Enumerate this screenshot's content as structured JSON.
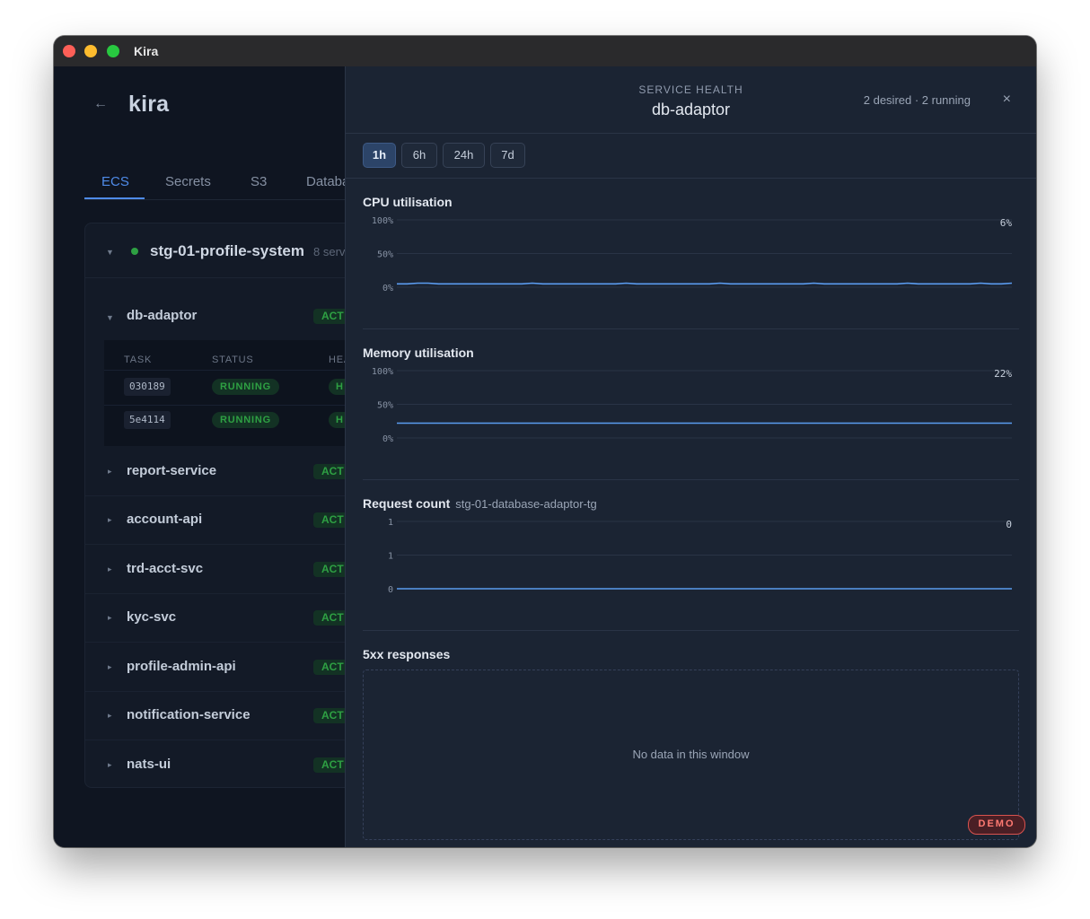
{
  "window": {
    "title": "Kira"
  },
  "app": {
    "title": "kira",
    "tabs": [
      "ECS",
      "Secrets",
      "S3",
      "Databa"
    ],
    "active_tab": "ECS",
    "environment": {
      "name": "stg-01-profile-system",
      "count_text": "8 serv",
      "status_color": "#2ea043"
    },
    "services": [
      {
        "name": "db-adaptor",
        "status": "ACT",
        "expanded": true
      },
      {
        "name": "report-service",
        "status": "ACT"
      },
      {
        "name": "account-api",
        "status": "ACT"
      },
      {
        "name": "trd-acct-svc",
        "status": "ACT"
      },
      {
        "name": "kyc-svc",
        "status": "ACT"
      },
      {
        "name": "profile-admin-api",
        "status": "ACT"
      },
      {
        "name": "notification-service",
        "status": "ACT"
      },
      {
        "name": "nats-ui",
        "status": "ACT"
      }
    ],
    "tasks_table": {
      "headers": [
        "TASK",
        "STATUS",
        "HEA"
      ],
      "rows": [
        {
          "task": "030189",
          "status": "RUNNING",
          "health": "H"
        },
        {
          "task": "5e4114",
          "status": "RUNNING",
          "health": "H"
        }
      ]
    }
  },
  "drawer": {
    "label": "SERVICE HEALTH",
    "title": "db-adaptor",
    "meta": "2 desired · 2 running",
    "close": "×",
    "ranges": [
      "1h",
      "6h",
      "24h",
      "7d"
    ],
    "active_range": "1h",
    "charts": {
      "cpu": {
        "title": "CPU utilisation",
        "latest": "6%"
      },
      "memory": {
        "title": "Memory utilisation",
        "latest": "22%"
      },
      "requests": {
        "title": "Request count",
        "subtitle": "stg-01-database-adaptor-tg",
        "latest": "0"
      },
      "errors": {
        "title": "5xx responses",
        "empty_text": "No data in this window"
      }
    },
    "demo_badge": "DEMO"
  },
  "colors": {
    "accent": "#4f8be8",
    "success": "#2ea043",
    "line": "#5b9cf0",
    "demo": "#ff7a72"
  },
  "chart_data": [
    {
      "type": "line",
      "title": "CPU utilisation",
      "yticks": [
        "100%",
        "50%",
        "0%"
      ],
      "ylim": [
        0,
        100
      ],
      "unit": "%",
      "series": [
        {
          "values": [
            5,
            5,
            6,
            6,
            5,
            5,
            5,
            5,
            5,
            5,
            5,
            5,
            5,
            6,
            5,
            5,
            5,
            5,
            5,
            5,
            5,
            5,
            6,
            5,
            5,
            5,
            5,
            5,
            5,
            5,
            5,
            6,
            5,
            5,
            5,
            5,
            5,
            5,
            5,
            5,
            6,
            5,
            5,
            5,
            5,
            5,
            5,
            5,
            5,
            6,
            5,
            5,
            5,
            5,
            5,
            5,
            6,
            5,
            5,
            6
          ]
        }
      ],
      "latest": "6%",
      "grid": true
    },
    {
      "type": "line",
      "title": "Memory utilisation",
      "yticks": [
        "100%",
        "50%",
        "0%"
      ],
      "ylim": [
        0,
        100
      ],
      "unit": "%",
      "series": [
        {
          "values": [
            22,
            22,
            22,
            22,
            22,
            22,
            22,
            22,
            22,
            22,
            22,
            22,
            22,
            22,
            22,
            22,
            22,
            22,
            22,
            22,
            22,
            22,
            22,
            22,
            22,
            22,
            22,
            22,
            22,
            22,
            22,
            22,
            22,
            22,
            22,
            22,
            22,
            22,
            22,
            22,
            22,
            22,
            22,
            22,
            22,
            22,
            22,
            22,
            22,
            22,
            22,
            22,
            22,
            22,
            22,
            22,
            22,
            22,
            22,
            22
          ]
        }
      ],
      "latest": "22%",
      "grid": true
    },
    {
      "type": "line",
      "title": "Request count",
      "subtitle": "stg-01-database-adaptor-tg",
      "yticks": [
        "1",
        "1",
        "0"
      ],
      "ylim": [
        0,
        1
      ],
      "series": [
        {
          "values": [
            0,
            0,
            0,
            0,
            0,
            0,
            0,
            0,
            0,
            0,
            0,
            0,
            0,
            0,
            0,
            0,
            0,
            0,
            0,
            0,
            0,
            0,
            0,
            0,
            0,
            0,
            0,
            0,
            0,
            0,
            0,
            0,
            0,
            0,
            0,
            0,
            0,
            0,
            0,
            0,
            0,
            0,
            0,
            0,
            0,
            0,
            0,
            0,
            0,
            0,
            0,
            0,
            0,
            0,
            0,
            0,
            0,
            0,
            0,
            0
          ]
        }
      ],
      "latest": "0",
      "grid": true
    }
  ]
}
